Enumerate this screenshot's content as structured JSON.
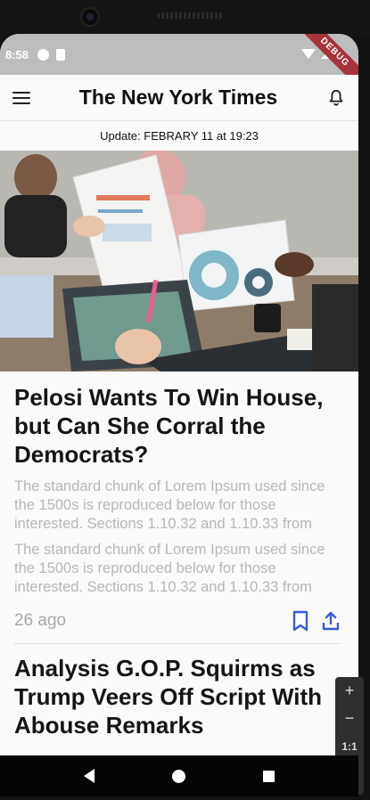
{
  "status_bar": {
    "time": "8:58",
    "debug_label": "DEBUG"
  },
  "app_bar": {
    "title": "The New York Times"
  },
  "update_text": "Update: FEBRARY 11 at 19:23",
  "articles": [
    {
      "headline": "Pelosi Wants To Win House, but Can  She Corral the Democrats?",
      "summaries": [
        "The standard chunk of Lorem Ipsum used since the 1500s is reproduced below for those interested. Sections 1.10.32 and 1.10.33 from",
        "The standard chunk of Lorem Ipsum used since the 1500s is reproduced below for those interested. Sections 1.10.32 and 1.10.33 from"
      ],
      "age": "26 ago"
    },
    {
      "headline": "Analysis G.O.P. Squirms as Trump Veers Off Script With Abouse Remarks"
    }
  ],
  "emulator_controls": {
    "zoom_in": "+",
    "zoom_out": "−",
    "ratio": "1:1"
  },
  "colors": {
    "accent": "#3b5bdb",
    "status_bar": "#bdbdbd",
    "debug_ribbon": "#a6343a"
  },
  "icons": {
    "menu": "menu-icon",
    "bell": "bell-icon",
    "bookmark": "bookmark-icon",
    "share": "share-icon"
  }
}
